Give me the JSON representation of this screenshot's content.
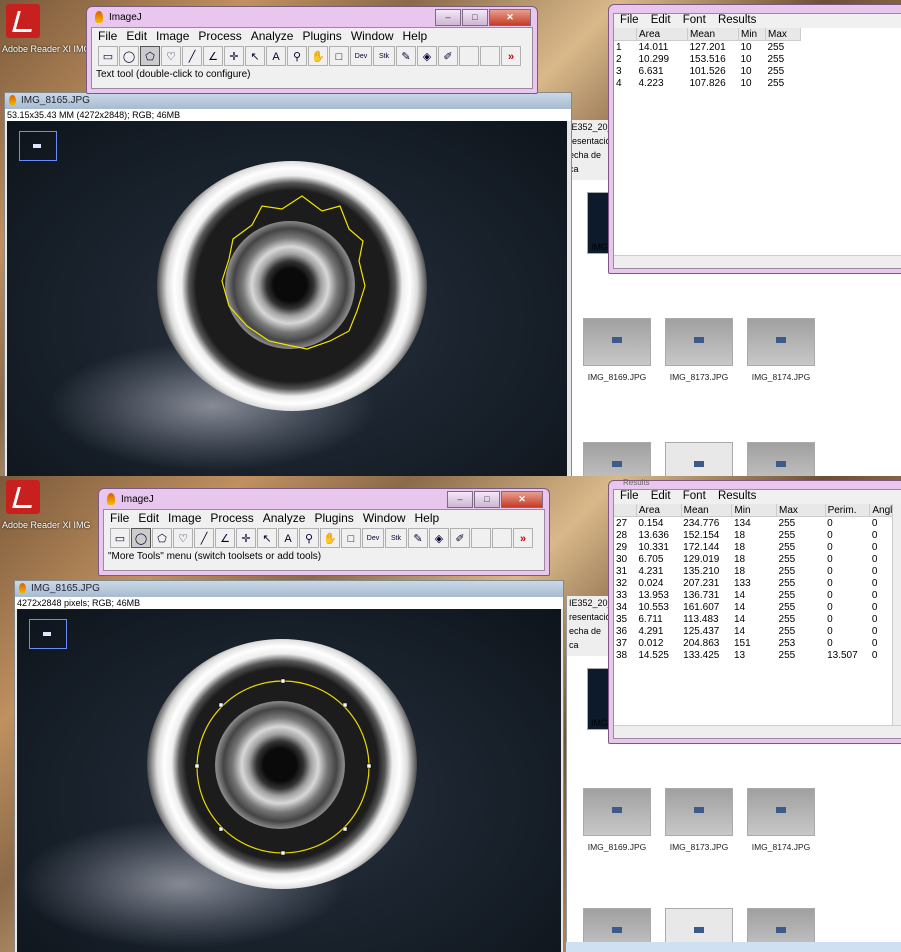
{
  "top": {
    "desktop_label": "Adobe Reader XI  IMG",
    "imagej": {
      "title": "ImageJ",
      "menu": [
        "File",
        "Edit",
        "Image",
        "Process",
        "Analyze",
        "Plugins",
        "Window",
        "Help"
      ],
      "status": "Text tool (double-click to configure)"
    },
    "image_window": {
      "title": "IMG_8165.JPG",
      "info": "53.15x35.43 MM (4272x2848); RGB; 46MB"
    },
    "explorer": {
      "strip": [
        "IE352_20_",
        "resentación",
        "echa de ca"
      ],
      "thumbs": [
        "IMG_8169.JPG",
        "IMG_8173.JPG",
        "IMG_8174.JPG"
      ],
      "mid_label": "IMG"
    },
    "results": {
      "menu": [
        "File",
        "Edit",
        "Font",
        "Results"
      ],
      "headers": [
        "",
        "Area",
        "Mean",
        "Min",
        "Max"
      ],
      "rows": [
        [
          "1",
          "14.011",
          "127.201",
          "10",
          "255"
        ],
        [
          "2",
          "10.299",
          "153.516",
          "10",
          "255"
        ],
        [
          "3",
          "6.631",
          "101.526",
          "10",
          "255"
        ],
        [
          "4",
          "4.223",
          "107.826",
          "10",
          "255"
        ]
      ]
    }
  },
  "bottom": {
    "desktop_label": "Adobe Reader XI  IMG",
    "imagej": {
      "title": "ImageJ",
      "menu": [
        "File",
        "Edit",
        "Image",
        "Process",
        "Analyze",
        "Plugins",
        "Window",
        "Help"
      ],
      "status": "\"More Tools\" menu (switch toolsets or add tools)"
    },
    "image_window": {
      "title": "IMG_8165.JPG",
      "info": "4272x2848 pixels; RGB; 46MB"
    },
    "explorer": {
      "strip": [
        "IE352_20_",
        "resentación",
        "echa de ca"
      ],
      "thumbs": [
        "IMG_8169.JPG",
        "IMG_8173.JPG",
        "IMG_8174.JPG"
      ],
      "mid_label": "IMG"
    },
    "results": {
      "title": "Results",
      "menu": [
        "File",
        "Edit",
        "Font",
        "Results"
      ],
      "headers": [
        "",
        "Area",
        "Mean",
        "Min",
        "Max",
        "Perim.",
        "Angle"
      ],
      "rows": [
        [
          "27",
          "0.154",
          "234.776",
          "134",
          "255",
          "0",
          "0"
        ],
        [
          "28",
          "13.636",
          "152.154",
          "18",
          "255",
          "0",
          "0"
        ],
        [
          "29",
          "10.331",
          "172.144",
          "18",
          "255",
          "0",
          "0"
        ],
        [
          "30",
          "6.705",
          "129.019",
          "18",
          "255",
          "0",
          "0"
        ],
        [
          "31",
          "4.231",
          "135.210",
          "18",
          "255",
          "0",
          "0"
        ],
        [
          "32",
          "0.024",
          "207.231",
          "133",
          "255",
          "0",
          "0"
        ],
        [
          "33",
          "13.953",
          "136.731",
          "14",
          "255",
          "0",
          "0"
        ],
        [
          "34",
          "10.553",
          "161.607",
          "14",
          "255",
          "0",
          "0"
        ],
        [
          "35",
          "6.711",
          "113.483",
          "14",
          "255",
          "0",
          "0"
        ],
        [
          "36",
          "4.291",
          "125.437",
          "14",
          "255",
          "0",
          "0"
        ],
        [
          "37",
          "0.012",
          "204.863",
          "151",
          "253",
          "0",
          "0"
        ],
        [
          "38",
          "14.525",
          "133.425",
          "13",
          "255",
          "13.507",
          "0"
        ]
      ]
    }
  }
}
